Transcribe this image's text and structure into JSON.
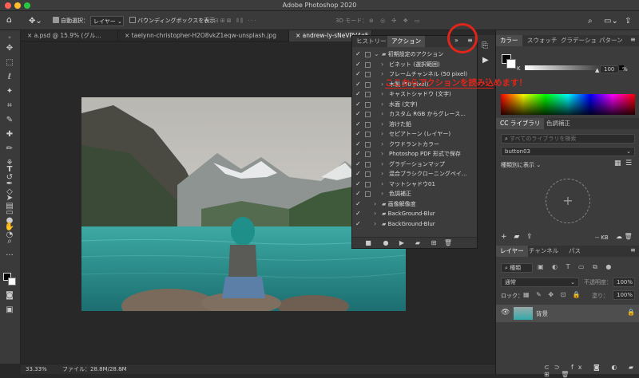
{
  "app": {
    "title": "Adobe Photoshop 2020"
  },
  "options_bar": {
    "auto_select_label": "自動選択：",
    "layer_select": "レイヤー",
    "bounding_box_label": "バウンディングボックスを表示",
    "mode_3d_label": "3D モード："
  },
  "doc_tabs": [
    {
      "label": "a.psd @ 15.9% (グル..."
    },
    {
      "label": "taelynn-christopher-H2O8vkZ1eqw-unsplash.jpg"
    },
    {
      "label": "andrew-ly-sNeVPV4g5"
    }
  ],
  "status": {
    "zoom": "33.33%",
    "file_info": "ファイル：28.8M/28.8M"
  },
  "actions_panel": {
    "tabs": [
      "ヒストリー",
      "アクション"
    ],
    "set_name": "初期設定のアクション",
    "items": [
      "ビネット (選択範囲)",
      "フレームチャンネル (50 pixel)",
      "木製 (50 pixel)",
      "キャストシャドウ (文字)",
      "水面 (文字)",
      "カスタム RGB からグレース...",
      "溶けた鉛",
      "セピアトーン (レイヤー)",
      "クワドラントカラー",
      "Photoshop PDF 形式で保存",
      "グラデーションマップ",
      "混合ブラシクローニングペイ...",
      "マットシャドウ01",
      "色調補正"
    ],
    "sets": [
      "画像解像度",
      "BackGround-Blur",
      "BackGround-Blur"
    ]
  },
  "annotation": {
    "text": "ここからアクションを読み込めます！",
    "color": "#e0251b"
  },
  "color_panel": {
    "tabs": [
      "カラー",
      "スウォッチ",
      "グラデーショ",
      "パターン"
    ],
    "k_label": "K",
    "k_value": "100",
    "percent": "%"
  },
  "library_panel": {
    "tabs": [
      "CC ライブラリ",
      "色調補正"
    ],
    "search_placeholder": "すべてのライブラリを検索",
    "library_select": "button03",
    "view_label": "種類別に表示",
    "size_label": "-- KB"
  },
  "layers_panel": {
    "tabs": [
      "レイヤー",
      "チャンネル",
      "パス"
    ],
    "kind_select": "種類",
    "blend_mode": "通常",
    "opacity_label": "不透明度：",
    "opacity_value": "100%",
    "lock_label": "ロック：",
    "fill_label": "塗り：",
    "fill_value": "100%",
    "layer_name": "背景"
  }
}
